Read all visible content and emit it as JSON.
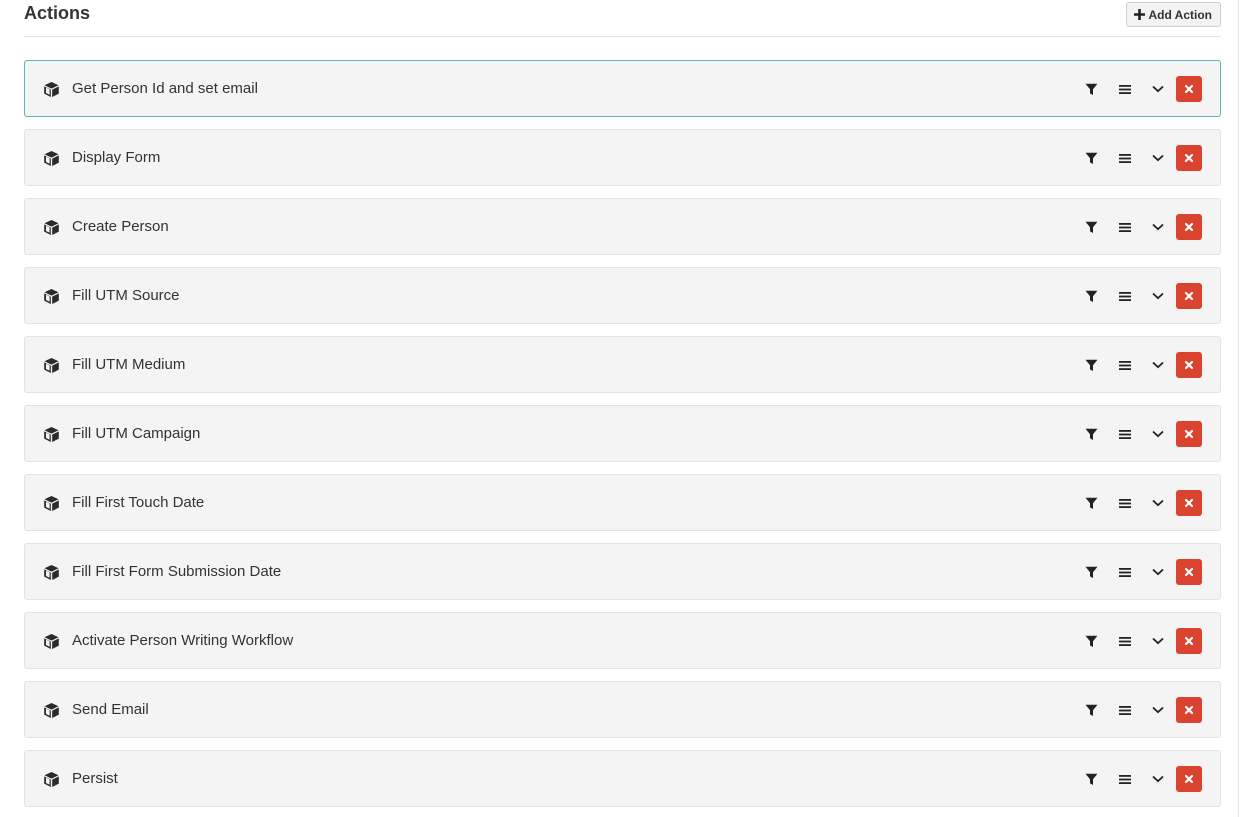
{
  "header": {
    "title": "Actions",
    "add_button_label": "Add Action"
  },
  "colors": {
    "delete": "#d9432f",
    "active_border": "#57b9b4",
    "row_background": "#f4f4f4"
  },
  "icons": {
    "row_icon": "cube-icon",
    "controls": [
      "filter-icon",
      "menu-icon",
      "chevron-down-icon",
      "close-icon"
    ]
  },
  "actions": [
    {
      "label": "Get Person Id and set email",
      "active": true
    },
    {
      "label": "Display Form",
      "active": false
    },
    {
      "label": "Create Person",
      "active": false
    },
    {
      "label": "Fill UTM Source",
      "active": false
    },
    {
      "label": "Fill UTM Medium",
      "active": false
    },
    {
      "label": "Fill UTM Campaign",
      "active": false
    },
    {
      "label": "Fill First Touch Date",
      "active": false
    },
    {
      "label": "Fill First Form Submission Date",
      "active": false
    },
    {
      "label": "Activate Person Writing Workflow",
      "active": false
    },
    {
      "label": "Send Email",
      "active": false
    },
    {
      "label": "Persist",
      "active": false
    }
  ]
}
